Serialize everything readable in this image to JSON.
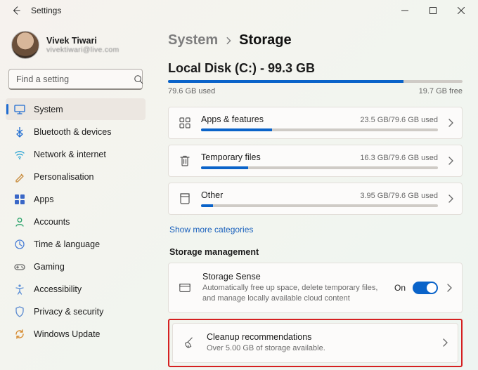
{
  "window": {
    "title": "Settings"
  },
  "profile": {
    "name": "Vivek Tiwari",
    "email": "vivektiwari@live.com"
  },
  "search": {
    "placeholder": "Find a setting"
  },
  "nav": [
    {
      "icon": "system",
      "label": "System",
      "selected": true
    },
    {
      "icon": "bluetooth",
      "label": "Bluetooth & devices",
      "selected": false
    },
    {
      "icon": "network",
      "label": "Network & internet",
      "selected": false
    },
    {
      "icon": "personal",
      "label": "Personalisation",
      "selected": false
    },
    {
      "icon": "apps",
      "label": "Apps",
      "selected": false
    },
    {
      "icon": "accounts",
      "label": "Accounts",
      "selected": false
    },
    {
      "icon": "time",
      "label": "Time & language",
      "selected": false
    },
    {
      "icon": "gaming",
      "label": "Gaming",
      "selected": false
    },
    {
      "icon": "access",
      "label": "Accessibility",
      "selected": false
    },
    {
      "icon": "privacy",
      "label": "Privacy & security",
      "selected": false
    },
    {
      "icon": "update",
      "label": "Windows Update",
      "selected": false
    }
  ],
  "breadcrumb": {
    "parent": "System",
    "current": "Storage"
  },
  "disk": {
    "title": "Local Disk (C:) - 99.3 GB",
    "used_label": "79.6 GB used",
    "free_label": "19.7 GB free",
    "used_pct": 80
  },
  "categories": [
    {
      "icon": "apps-grid",
      "name": "Apps & features",
      "used": "23.5 GB/79.6 GB used",
      "pct": 30
    },
    {
      "icon": "trash",
      "name": "Temporary files",
      "used": "16.3 GB/79.6 GB used",
      "pct": 20
    },
    {
      "icon": "other",
      "name": "Other",
      "used": "3.95 GB/79.6 GB used",
      "pct": 5
    }
  ],
  "show_more": "Show more categories",
  "management": {
    "heading": "Storage management",
    "storage_sense": {
      "title": "Storage Sense",
      "desc": "Automatically free up space, delete temporary files, and manage locally available cloud content",
      "state_label": "On",
      "on": true
    },
    "cleanup": {
      "title": "Cleanup recommendations",
      "desc": "Over 5.00 GB of storage available."
    }
  }
}
